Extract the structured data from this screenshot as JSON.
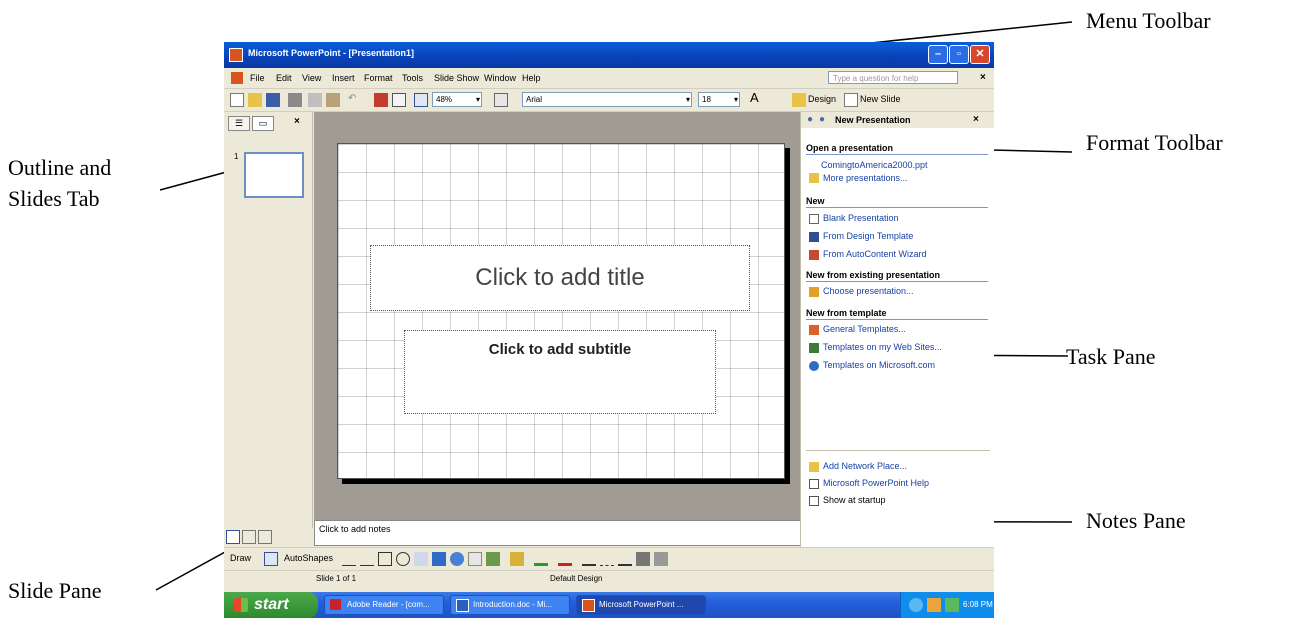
{
  "callouts": {
    "menu_toolbar": "Menu Toolbar",
    "format_toolbar": "Format Toolbar",
    "outline_slides_1": "Outline and",
    "outline_slides_2": "Slides Tab",
    "task_pane": "Task Pane",
    "slide_pane": "Slide Pane",
    "notes_pane": "Notes Pane"
  },
  "window": {
    "title": "Microsoft PowerPoint - [Presentation1]"
  },
  "menu": {
    "items": [
      "File",
      "Edit",
      "View",
      "Insert",
      "Format",
      "Tools",
      "Slide Show",
      "Window",
      "Help"
    ],
    "ask_placeholder": "Type a question for help",
    "close": "×"
  },
  "toolbar": {
    "zoom": "48%",
    "font": "Arial",
    "size": "18",
    "design": "Design",
    "new_slide": "New Slide",
    "grow_font": "A"
  },
  "left_pane": {
    "tabs": [
      "☰",
      "▭"
    ],
    "close": "×",
    "slide_number": "1"
  },
  "slide": {
    "title_placeholder": "Click to add title",
    "subtitle_placeholder": "Click to add subtitle"
  },
  "notes": {
    "placeholder": "Click to add notes"
  },
  "task_pane": {
    "title": "New Presentation",
    "close": "×",
    "open_heading": "Open a presentation",
    "recent_file": "ComingtoAmerica2000.ppt",
    "more_presentations": "More presentations...",
    "new_heading": "New",
    "blank_presentation": "Blank Presentation",
    "from_design_template": "From Design Template",
    "from_autocontent": "From AutoContent Wizard",
    "existing_heading": "New from existing presentation",
    "choose_presentation": "Choose presentation...",
    "template_heading": "New from template",
    "general_templates": "General Templates...",
    "templates_web": "Templates on my Web Sites...",
    "templates_microsoft": "Templates on Microsoft.com",
    "add_network_place": "Add Network Place...",
    "ppt_help": "Microsoft PowerPoint Help",
    "show_at_startup": "Show at startup"
  },
  "drawbar": {
    "draw": "Draw",
    "autoshapes": "AutoShapes"
  },
  "status": {
    "slide": "Slide 1 of 1",
    "design": "Default Design"
  },
  "taskbar": {
    "start": "start",
    "tasks": [
      "Adobe Reader - [com...",
      "Introduction.doc - Mi...",
      "Microsoft PowerPoint ..."
    ],
    "clock": "6:08 PM"
  },
  "colors": {
    "title_bar": "#0a5fd9",
    "start_button": "#2d8a2d",
    "taskbar": "#245edb",
    "link": "#1842a5"
  }
}
